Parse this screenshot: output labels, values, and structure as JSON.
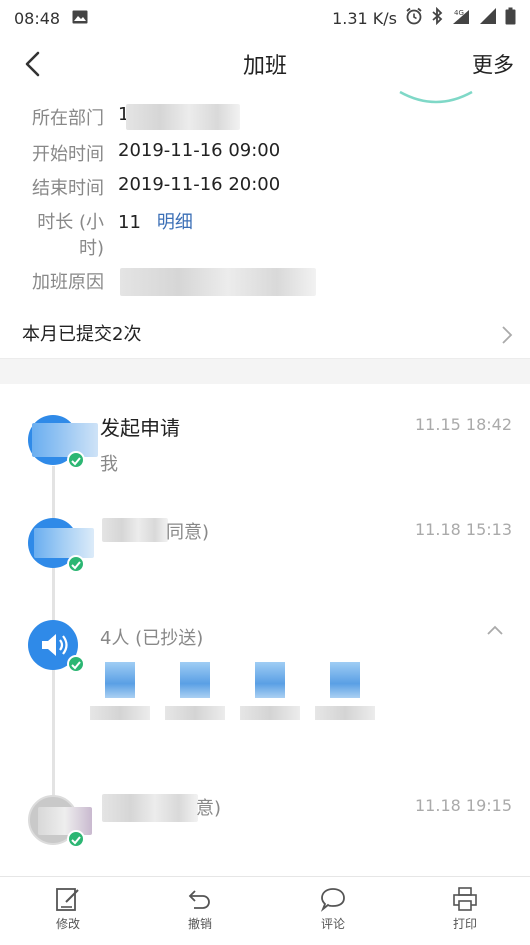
{
  "status": {
    "time": "08:48",
    "speed": "1.31 K/s"
  },
  "nav": {
    "title": "加班",
    "more": "更多"
  },
  "fields": {
    "department_label": "所在部门",
    "department_value_prefix": "1",
    "start_label": "开始时间",
    "start_value": "2019-11-16 09:00",
    "end_label": "结束时间",
    "end_value": "2019-11-16 20:00",
    "duration_label_1": "时长 (小",
    "duration_label_2": "时)",
    "duration_value": "11",
    "duration_link": "明细",
    "reason_label": "加班原因"
  },
  "submitted_text": "本月已提交2次",
  "timeline": [
    {
      "title": "发起申请",
      "sub": "我",
      "time": "11.15 18:42"
    },
    {
      "title_suffix": "同意)",
      "time": "11.18 15:13"
    },
    {
      "title": "4人 (已抄送)"
    },
    {
      "title_suffix": "意)",
      "time": "11.18 19:15"
    }
  ],
  "tabs": {
    "edit": "修改",
    "revoke": "撤销",
    "comment": "评论",
    "print": "打印"
  },
  "colors": {
    "accent": "#2f8ae8",
    "check": "#2cb673",
    "link": "#3b6fb6"
  }
}
